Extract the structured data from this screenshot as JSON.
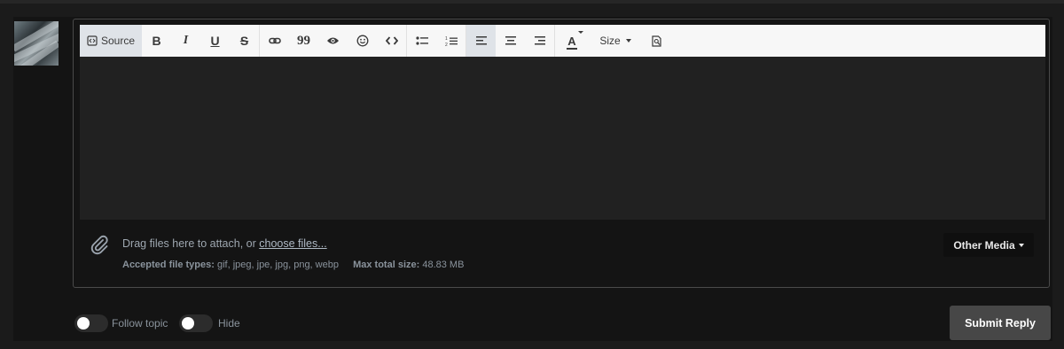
{
  "toolbar": {
    "source_label": "Source",
    "bold_label": "B",
    "italic_label": "I",
    "underline_label": "U",
    "strike_label": "S",
    "quote_label": "99",
    "font_color_label": "A",
    "size_label": "Size",
    "buttons": [
      "source-mode",
      "bold",
      "italic",
      "underline",
      "strikethrough",
      "link",
      "quote",
      "spoiler",
      "emoji",
      "code",
      "bullet-list",
      "numbered-list",
      "align-left",
      "align-center",
      "align-right",
      "font-color",
      "size",
      "preview"
    ],
    "active_align": "left"
  },
  "attach": {
    "drop_prefix": "Drag files here to attach, or ",
    "drop_link": "choose files...",
    "accepted_label": "Accepted file types:",
    "accepted_value": "gif, jpeg, jpe, jpg, png, webp",
    "max_label": "Max total size:",
    "max_value": "48.83 MB",
    "other_media_label": "Other Media"
  },
  "options": {
    "follow_label": "Follow topic",
    "hide_label": "Hide",
    "follow_on": false,
    "hide_on": false
  },
  "submit_label": "Submit Reply",
  "colors": {
    "page_bg": "#1b1b1b",
    "panel_bg": "#141414",
    "editor_bg": "#212121",
    "toolbar_bg": "#f7f7f7",
    "submit_bg": "#474747"
  }
}
